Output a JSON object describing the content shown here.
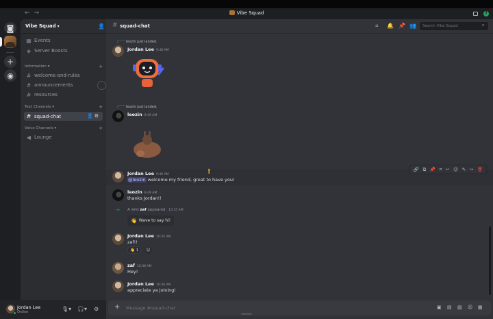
{
  "window": {
    "title": "Vibe Squad",
    "nav_glyphs": "←→"
  },
  "server": {
    "name": "Vibe Squad"
  },
  "sidebar": {
    "top_items": [
      {
        "label": "Events"
      },
      {
        "label": "Server Boosts"
      }
    ],
    "categories": {
      "information": "Information",
      "text": "Text Channels",
      "voice": "Voice Channels"
    },
    "info_channels": [
      {
        "label": "welcome-and-rules"
      },
      {
        "label": "announcements"
      },
      {
        "label": "resources"
      }
    ],
    "text_channels": [
      {
        "label": "squad-chat"
      }
    ],
    "voice_channels": [
      {
        "label": "Lounge"
      }
    ]
  },
  "user_panel": {
    "name": "Jordan Lee",
    "status": "Online"
  },
  "chat": {
    "channel": "squad-chat",
    "search_placeholder": "Search Vibe Squad",
    "composer_placeholder": "Message #squad-chat",
    "messages": [
      {
        "reply_to": "leozin just landed.",
        "author": "Jordan Lee",
        "time": "9:48 AM",
        "sticker": "robot-wave"
      },
      {
        "reply_to": "leozin just landed.",
        "author": "leozin",
        "time": "9:49 AM",
        "sticker": "bunny"
      },
      {
        "author": "Jordan Lee",
        "time": "9:49 AM",
        "mention": "@leozin",
        "text": " welcome my friend, great to have you!"
      },
      {
        "author": "leozin",
        "time": "9:49 AM",
        "text": "thanks Jordan!!"
      },
      {
        "system_prefix": "A wild ",
        "system_user": "zaf",
        "system_suffix": " appeared.",
        "time": "10:35 AM",
        "button": "Wave to say hi!"
      },
      {
        "author": "Jordan Lee",
        "time": "10:35 AM",
        "text": "zaf!!",
        "reaction_count": "1"
      },
      {
        "author": "zaf",
        "time": "10:36 AM",
        "text": "Hey!"
      },
      {
        "author": "Jordan Lee",
        "time": "10:36 AM",
        "text": "appreciate ya joining!"
      }
    ]
  },
  "colors": {
    "online": "#23a55a",
    "danger": "#f23f43",
    "mention_bg": "#3c4270"
  }
}
